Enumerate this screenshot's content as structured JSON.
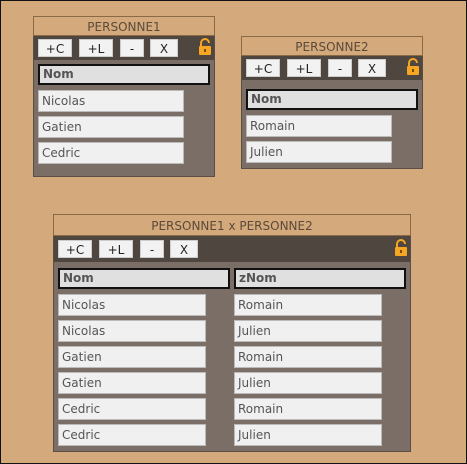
{
  "toolbar": {
    "add_column": "+C",
    "add_line": "+L",
    "remove": "-",
    "close": "X"
  },
  "lock_icon": "open-padlock-icon",
  "colors": {
    "background": "#d4aa7d",
    "panel_body": "#7a6e66",
    "toolbar": "#4f4640",
    "lock": "#f5a623"
  },
  "personne1": {
    "title": "PERSONNE1",
    "column": "Nom",
    "rows": [
      "Nicolas",
      "Gatien",
      "Cedric"
    ]
  },
  "personne2": {
    "title": "PERSONNE2",
    "column": "Nom",
    "rows": [
      "Romain",
      "Julien"
    ]
  },
  "product": {
    "title": "PERSONNE1 x PERSONNE2",
    "columns": [
      "Nom",
      "zNom"
    ],
    "rows": [
      [
        "Nicolas",
        "Romain"
      ],
      [
        "Nicolas",
        "Julien"
      ],
      [
        "Gatien",
        "Romain"
      ],
      [
        "Gatien",
        "Julien"
      ],
      [
        "Cedric",
        "Romain"
      ],
      [
        "Cedric",
        "Julien"
      ]
    ]
  }
}
